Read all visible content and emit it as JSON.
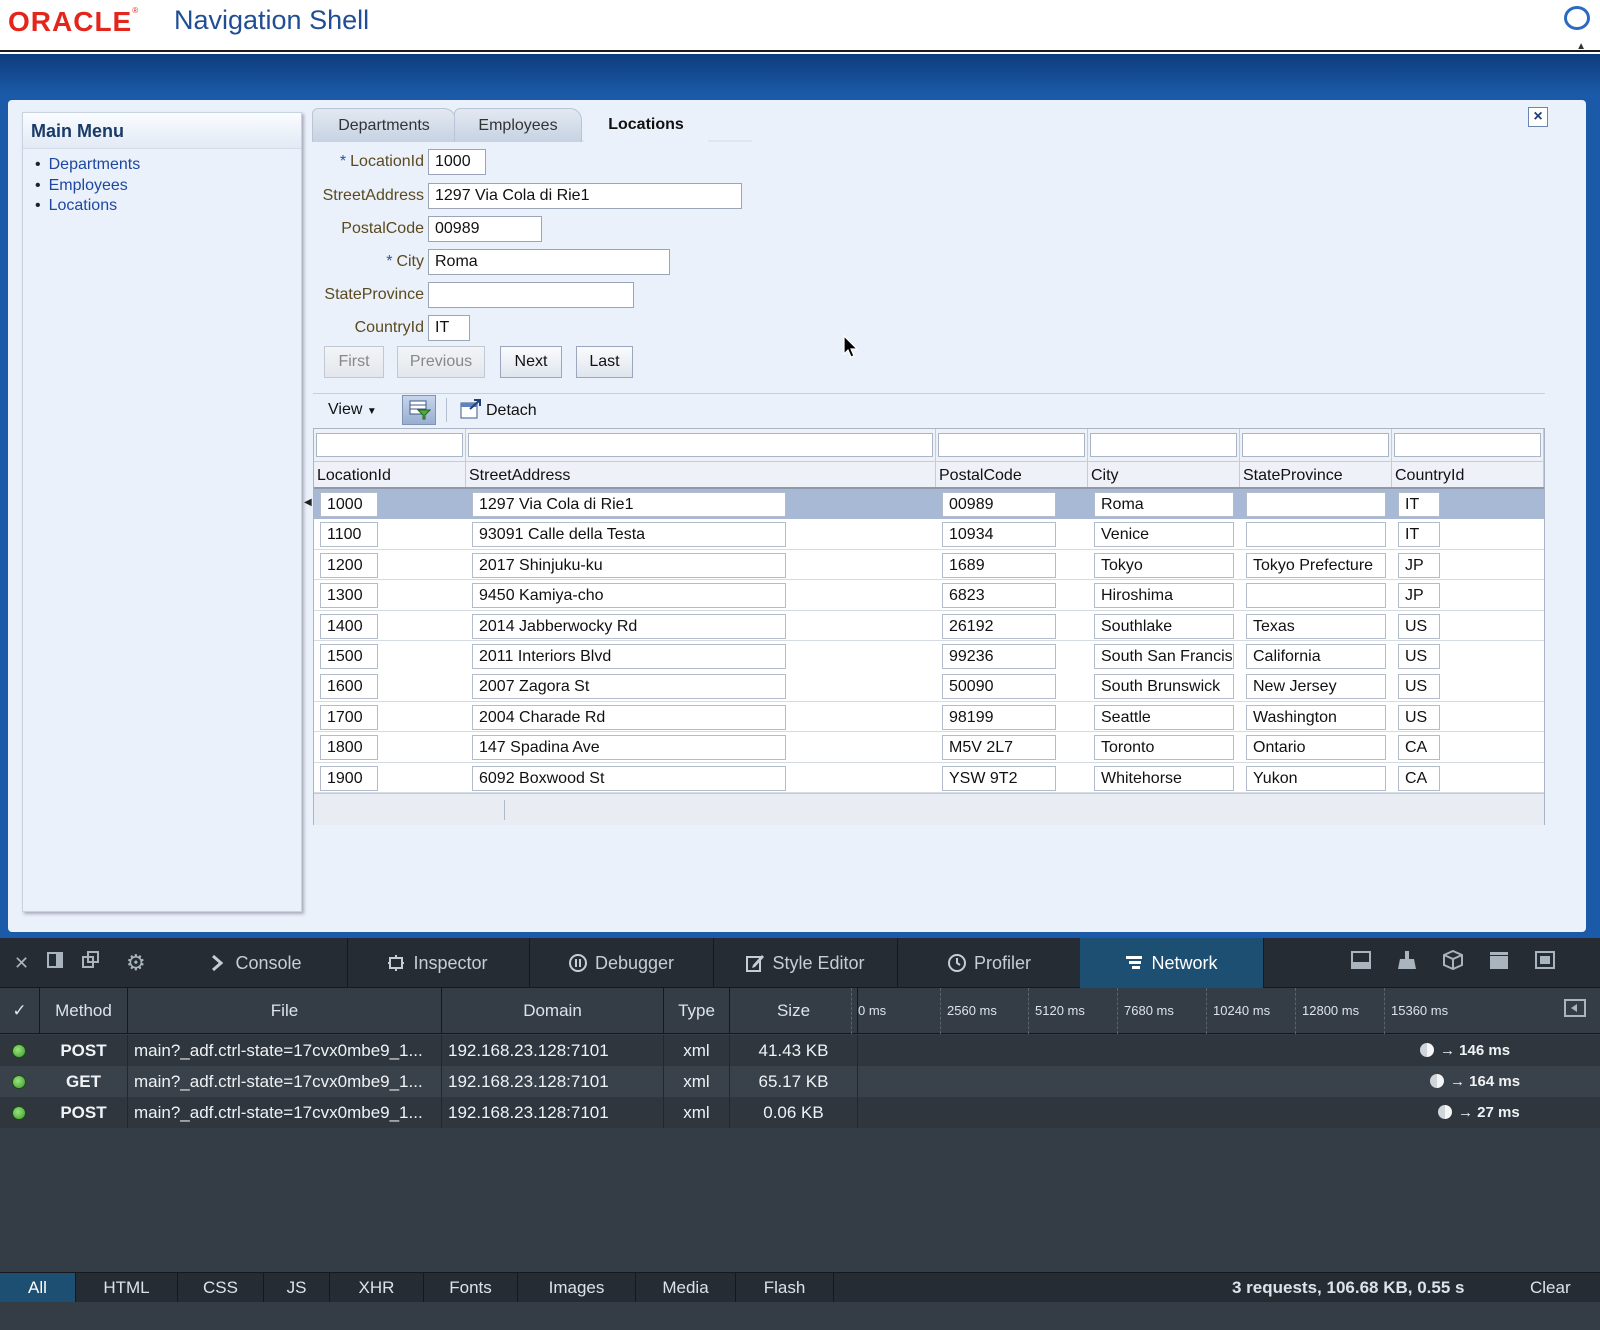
{
  "header": {
    "logo": "ORACLE",
    "title": "Navigation Shell"
  },
  "sidebar": {
    "title": "Main Menu",
    "items": [
      {
        "label": "Departments"
      },
      {
        "label": "Employees"
      },
      {
        "label": "Locations"
      }
    ]
  },
  "tabs": [
    {
      "label": "Departments",
      "active": false
    },
    {
      "label": "Employees",
      "active": false
    },
    {
      "label": "Locations",
      "active": true
    }
  ],
  "close_label": "×",
  "form": {
    "fields": [
      {
        "label": "LocationId",
        "required": true,
        "value": "1000"
      },
      {
        "label": "StreetAddress",
        "required": false,
        "value": "1297 Via Cola di Rie1"
      },
      {
        "label": "PostalCode",
        "required": false,
        "value": "00989"
      },
      {
        "label": "City",
        "required": true,
        "value": "Roma"
      },
      {
        "label": "StateProvince",
        "required": false,
        "value": ""
      },
      {
        "label": "CountryId",
        "required": false,
        "value": "IT"
      }
    ],
    "required_mark": "*",
    "buttons": {
      "first": "First",
      "previous": "Previous",
      "next": "Next",
      "last": "Last"
    }
  },
  "table_toolbar": {
    "view": "View",
    "detach": "Detach"
  },
  "table": {
    "columns": [
      "LocationId",
      "StreetAddress",
      "PostalCode",
      "City",
      "StateProvince",
      "CountryId"
    ],
    "rows": [
      [
        "1000",
        "1297 Via Cola di Rie1",
        "00989",
        "Roma",
        "",
        "IT"
      ],
      [
        "1100",
        "93091 Calle della Testa",
        "10934",
        "Venice",
        "",
        "IT"
      ],
      [
        "1200",
        "2017 Shinjuku-ku",
        "1689",
        "Tokyo",
        "Tokyo Prefecture",
        "JP"
      ],
      [
        "1300",
        "9450 Kamiya-cho",
        "6823",
        "Hiroshima",
        "",
        "JP"
      ],
      [
        "1400",
        "2014 Jabberwocky Rd",
        "26192",
        "Southlake",
        "Texas",
        "US"
      ],
      [
        "1500",
        "2011 Interiors Blvd",
        "99236",
        "South San Francisco",
        "California",
        "US"
      ],
      [
        "1600",
        "2007 Zagora St",
        "50090",
        "South Brunswick",
        "New Jersey",
        "US"
      ],
      [
        "1700",
        "2004 Charade Rd",
        "98199",
        "Seattle",
        "Washington",
        "US"
      ],
      [
        "1800",
        "147 Spadina Ave",
        "M5V 2L7",
        "Toronto",
        "Ontario",
        "CA"
      ],
      [
        "1900",
        "6092 Boxwood St",
        "YSW 9T2",
        "Whitehorse",
        "Yukon",
        "CA"
      ]
    ],
    "selected_row": 0
  },
  "devtools": {
    "tabs": [
      {
        "label": "Console",
        "icon": "chevron-right-icon"
      },
      {
        "label": "Inspector",
        "icon": "inspector-icon"
      },
      {
        "label": "Debugger",
        "icon": "pause-icon"
      },
      {
        "label": "Style Editor",
        "icon": "edit-icon"
      },
      {
        "label": "Profiler",
        "icon": "clock-icon"
      },
      {
        "label": "Network",
        "icon": "network-icon"
      }
    ],
    "active_tab": "Network",
    "network": {
      "check": "✓",
      "headers": {
        "method": "Method",
        "file": "File",
        "domain": "Domain",
        "type": "Type",
        "size": "Size"
      },
      "ticks": [
        "0 ms",
        "2560 ms",
        "5120 ms",
        "7680 ms",
        "10240 ms",
        "12800 ms",
        "15360 ms"
      ],
      "requests": [
        {
          "method": "POST",
          "file": "main?_adf.ctrl-state=17cvx0mbe9_1...",
          "domain": "192.168.23.128:7101",
          "type": "xml",
          "size": "41.43 KB",
          "timing": "→ 146 ms"
        },
        {
          "method": "GET",
          "file": "main?_adf.ctrl-state=17cvx0mbe9_1...",
          "domain": "192.168.23.128:7101",
          "type": "xml",
          "size": "65.17 KB",
          "timing": "→ 164 ms"
        },
        {
          "method": "POST",
          "file": "main?_adf.ctrl-state=17cvx0mbe9_1...",
          "domain": "192.168.23.128:7101",
          "type": "xml",
          "size": "0.06 KB",
          "timing": "→ 27 ms"
        }
      ],
      "filters": [
        "All",
        "HTML",
        "CSS",
        "JS",
        "XHR",
        "Fonts",
        "Images",
        "Media",
        "Flash"
      ],
      "active_filter": "All",
      "summary": "3 requests, 106.68 KB, 0.55 s",
      "clear": "Clear"
    }
  }
}
